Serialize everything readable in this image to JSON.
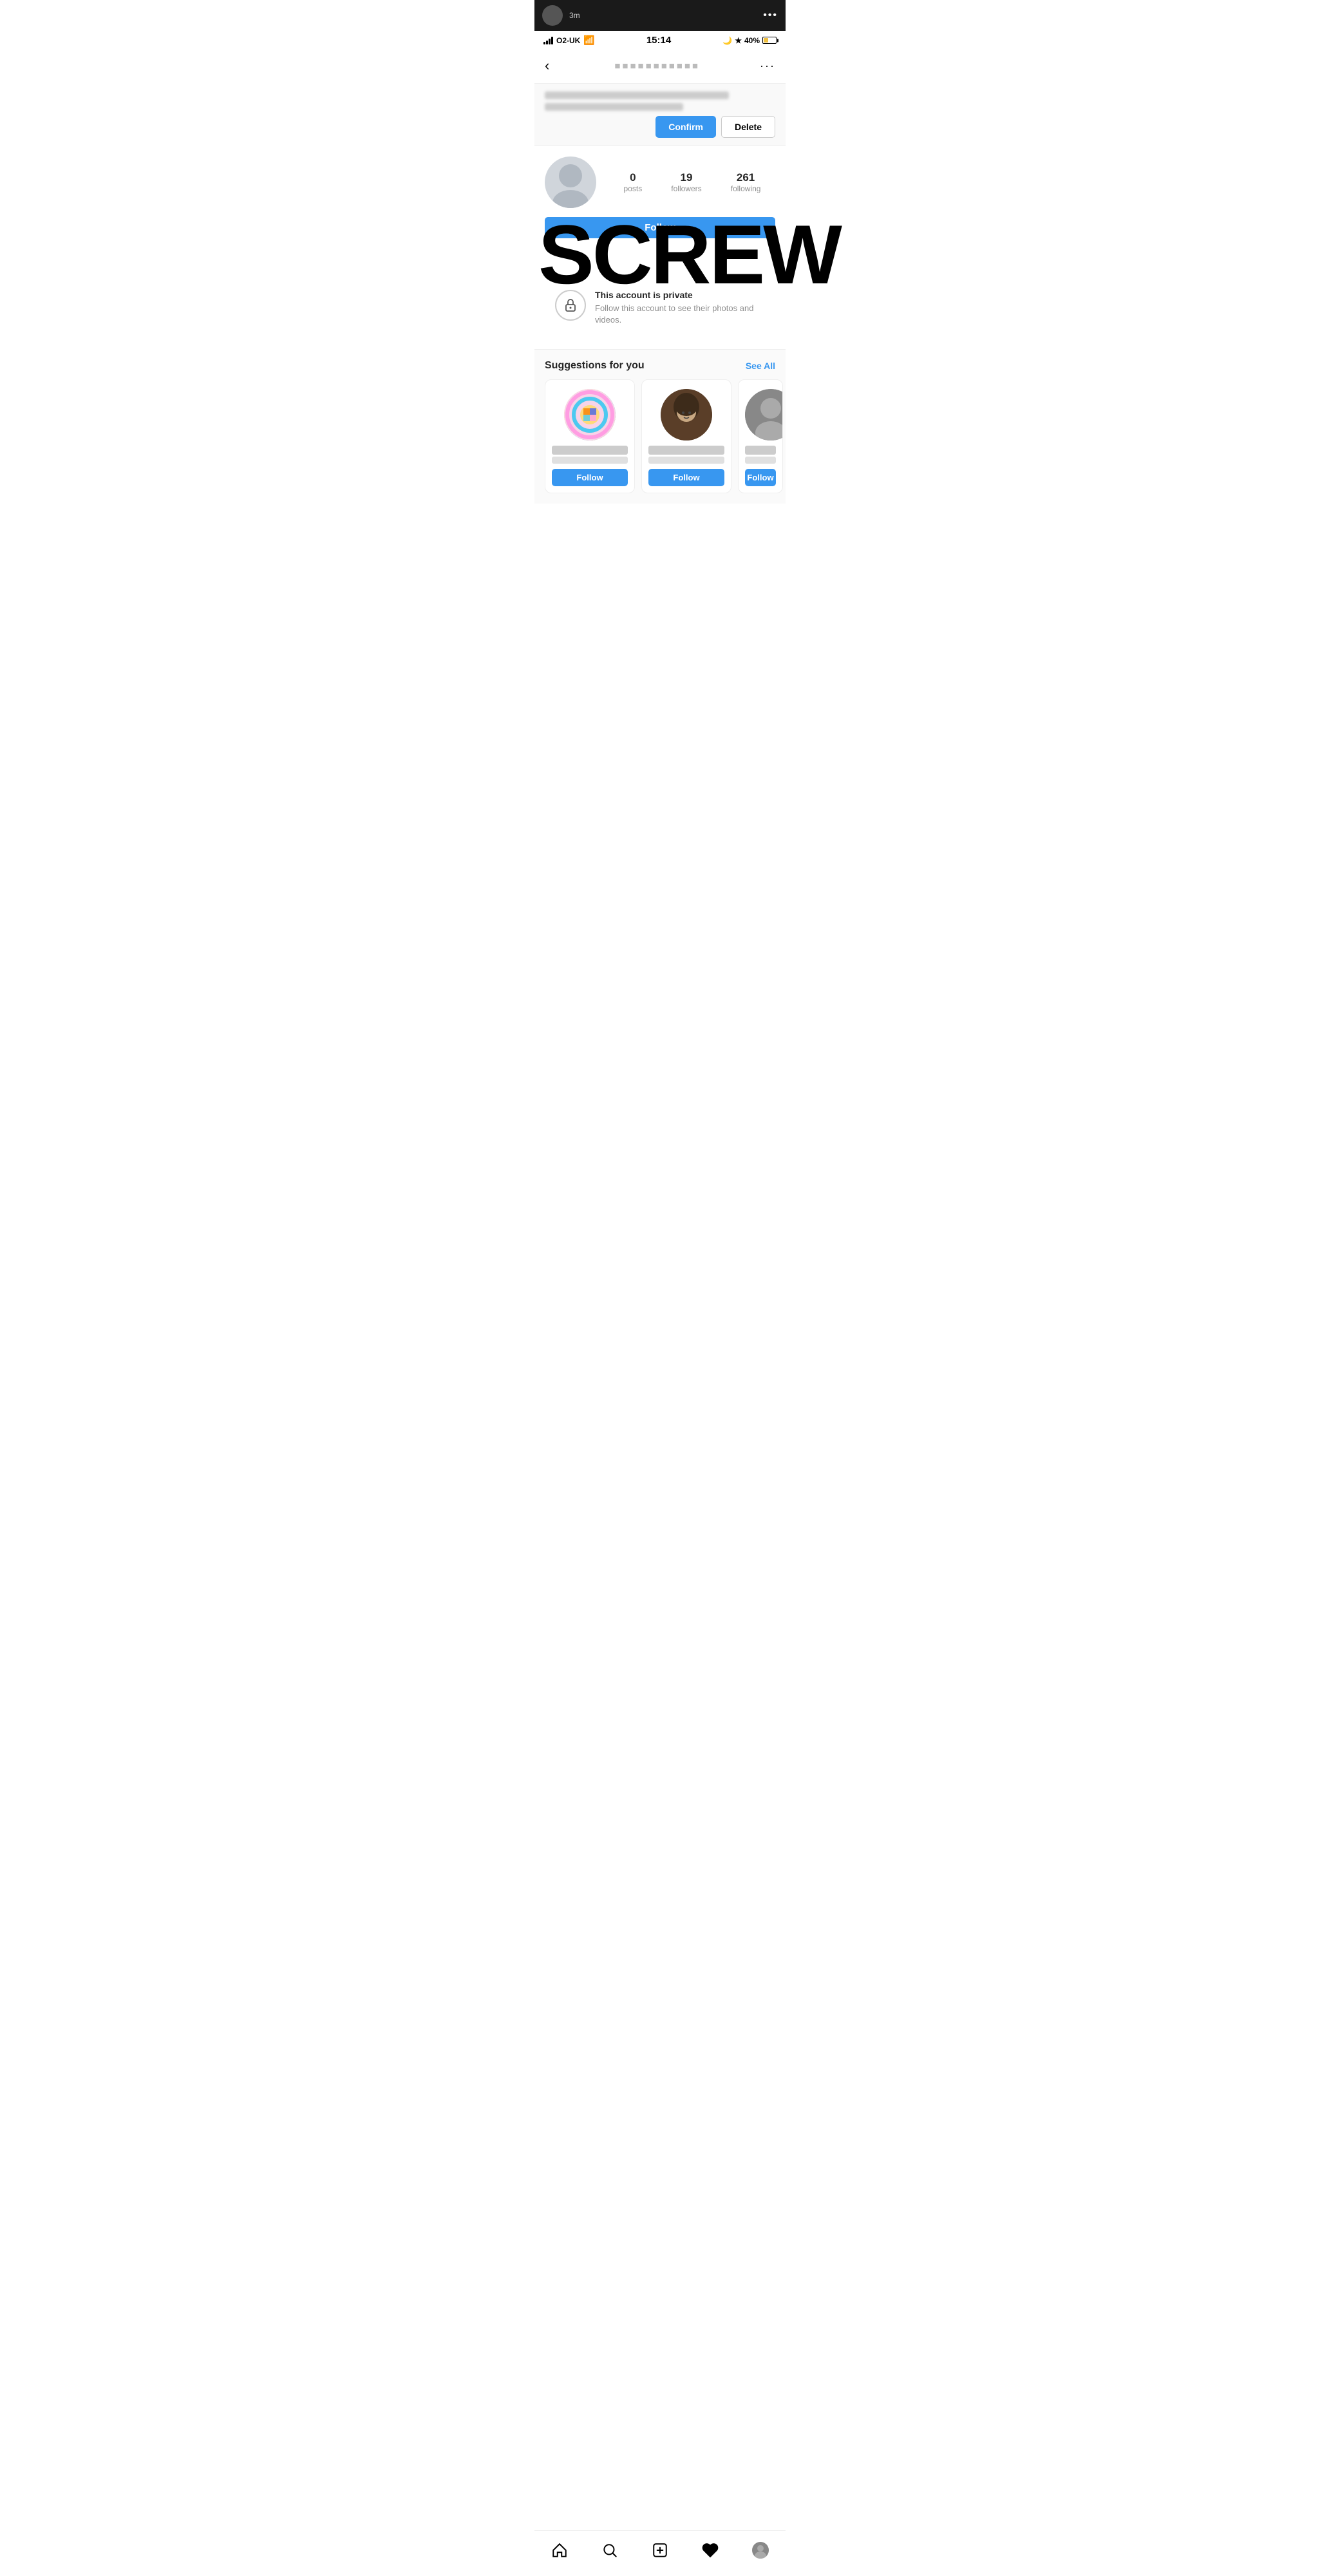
{
  "notification": {
    "time": "3m",
    "dots": "•••"
  },
  "status_bar": {
    "carrier": "O2-UK",
    "time": "15:14",
    "battery_pct": "40%"
  },
  "nav": {
    "back": "<",
    "username": "••••••••••••",
    "more": "..."
  },
  "follow_request": {
    "text": "Wants to follow you",
    "confirm_label": "Confirm",
    "delete_label": "Delete"
  },
  "profile": {
    "posts_count": "0",
    "posts_label": "posts",
    "followers_count": "19",
    "followers_label": "followers",
    "following_count": "261",
    "following_label": "following",
    "follow_btn": "Follow"
  },
  "screw": {
    "text": "SCREW"
  },
  "private": {
    "title": "This account is private",
    "subtitle": "Follow this account to see their photos and videos."
  },
  "suggestions": {
    "title": "Suggestions for you",
    "see_all": "See All",
    "cards": [
      {
        "name": "••••••••",
        "sub": "•••••••",
        "follow": "Follow"
      },
      {
        "name": "••••••",
        "sub": "•••••",
        "follow": "Follow"
      },
      {
        "name": "•••••",
        "sub": "••••",
        "follow": "Follow"
      }
    ]
  },
  "bottom_nav": {
    "home": "home",
    "search": "search",
    "add": "add",
    "heart": "heart",
    "profile": "profile"
  }
}
